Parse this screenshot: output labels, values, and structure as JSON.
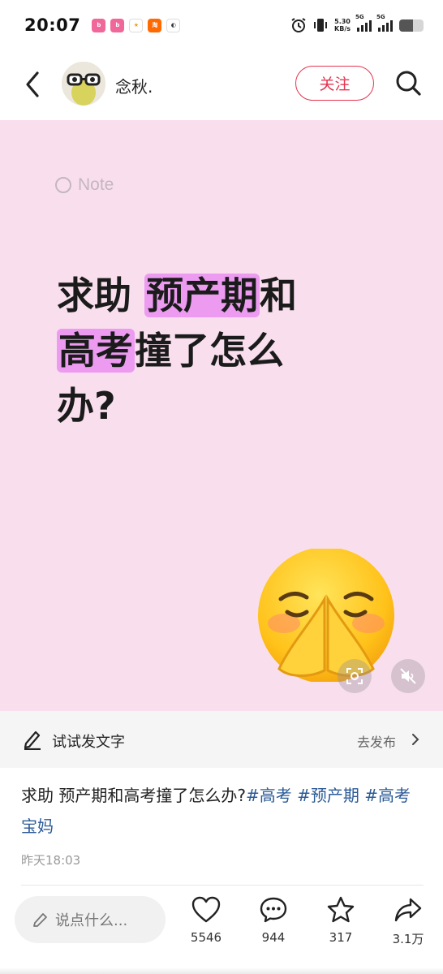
{
  "status_bar": {
    "time": "20:07",
    "net_speed_value": "5.30",
    "net_speed_unit": "KB/s",
    "signal_label_1": "5G",
    "signal_label_2": "5G",
    "app_icons": [
      "bilibili-icon",
      "bilibili-icon",
      "lottery-icon",
      "taobao-icon",
      "app-icon"
    ]
  },
  "header": {
    "author_name": "念秋.",
    "follow_label": "关注"
  },
  "cover": {
    "watermark": "Note",
    "headline": {
      "line1_plain": "求助 ",
      "line1_highlight": "预产期",
      "line1_tail": "和",
      "line2_highlight": "高考",
      "line2_tail": "撞了怎么",
      "line3": "办?"
    },
    "highlight_color": "#ec9bf0",
    "background_color": "#f9dfee"
  },
  "try_post": {
    "label": "试试发文字",
    "action": "去发布"
  },
  "post": {
    "text": "求助 预产期和高考撞了怎么办?",
    "tags": [
      "#高考",
      "#预产期",
      "#高考宝妈"
    ],
    "time": "昨天18:03"
  },
  "bottom_bar": {
    "comment_placeholder": "说点什么...",
    "like_count": "5546",
    "comment_count": "944",
    "favorite_count": "317",
    "share_count": "3.1万"
  },
  "colors": {
    "accent": "#e5344f",
    "tag": "#2b5a97"
  }
}
